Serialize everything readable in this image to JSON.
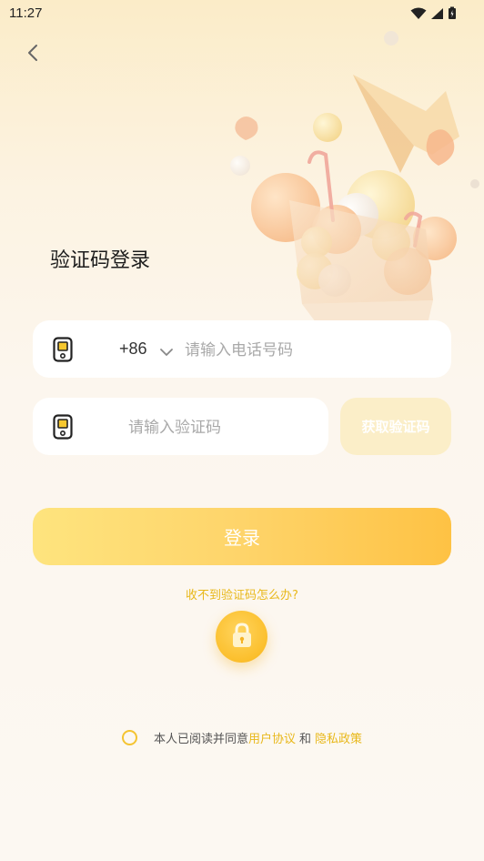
{
  "status_bar": {
    "time": "11:27"
  },
  "page": {
    "title": "验证码登录"
  },
  "phone_field": {
    "country_code": "+86",
    "placeholder": "请输入电话号码",
    "value": ""
  },
  "code_field": {
    "placeholder": "请输入验证码",
    "value": ""
  },
  "buttons": {
    "get_code": "获取验证码",
    "login": "登录"
  },
  "help": {
    "label": "收不到验证码怎么办?"
  },
  "agreement": {
    "prefix": "本人已阅读并同意",
    "user_agreement": "用户协议",
    "and": "和",
    "privacy_policy": "隐私政策",
    "checked": false
  },
  "colors": {
    "accent": "#fec244",
    "link": "#e8b81a",
    "get_code_bg": "#fbeec8"
  }
}
